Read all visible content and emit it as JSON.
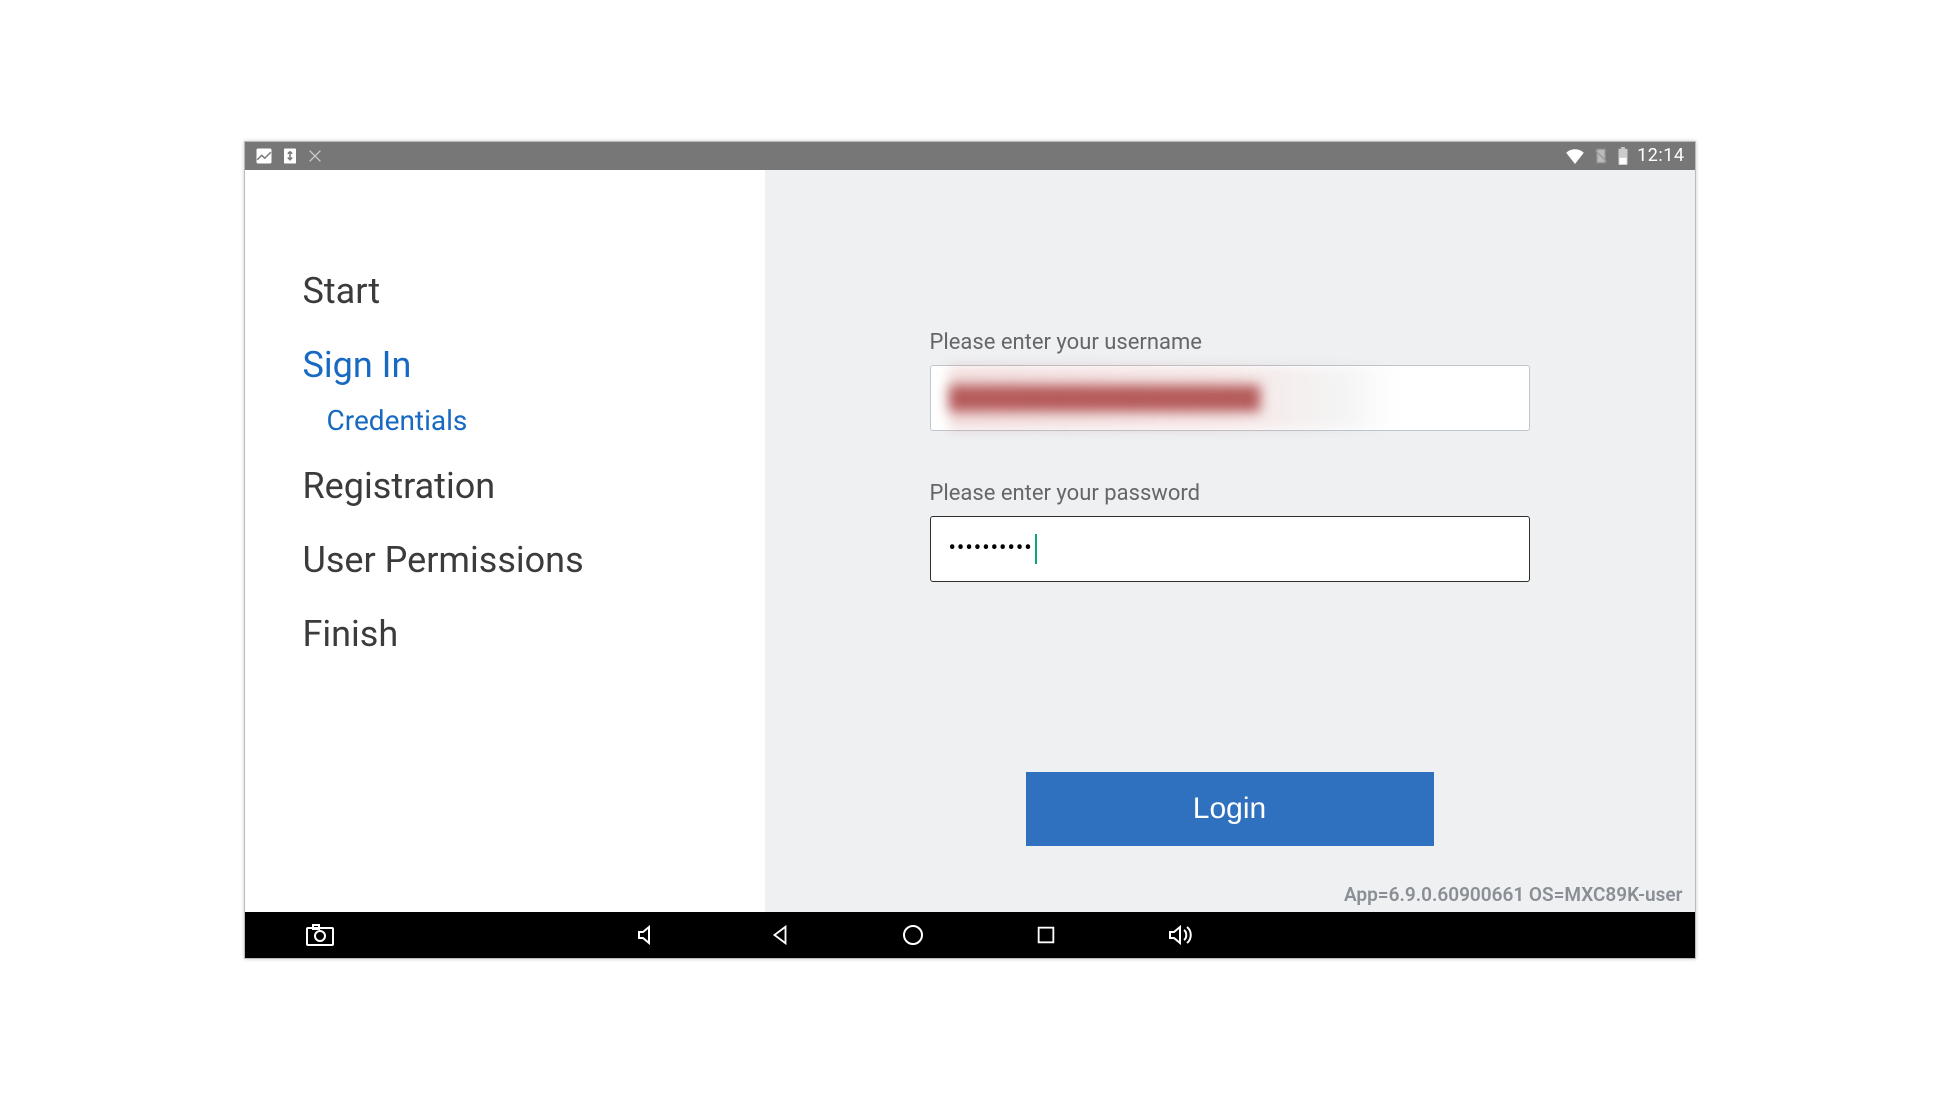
{
  "statusbar": {
    "time": "12:14"
  },
  "sidebar": {
    "items": [
      {
        "label": "Start",
        "active": false
      },
      {
        "label": "Sign In",
        "active": true
      },
      {
        "label": "Registration",
        "active": false
      },
      {
        "label": "User Permissions",
        "active": false
      },
      {
        "label": "Finish",
        "active": false
      }
    ],
    "sub": {
      "label": "Credentials"
    }
  },
  "form": {
    "username_label": "Please enter your username",
    "username_value": "",
    "password_label": "Please enter your password",
    "password_mask": "••••••••••",
    "login_label": "Login"
  },
  "footer": {
    "version": "App=6.9.0.60900661 OS=MXC89K-user"
  }
}
